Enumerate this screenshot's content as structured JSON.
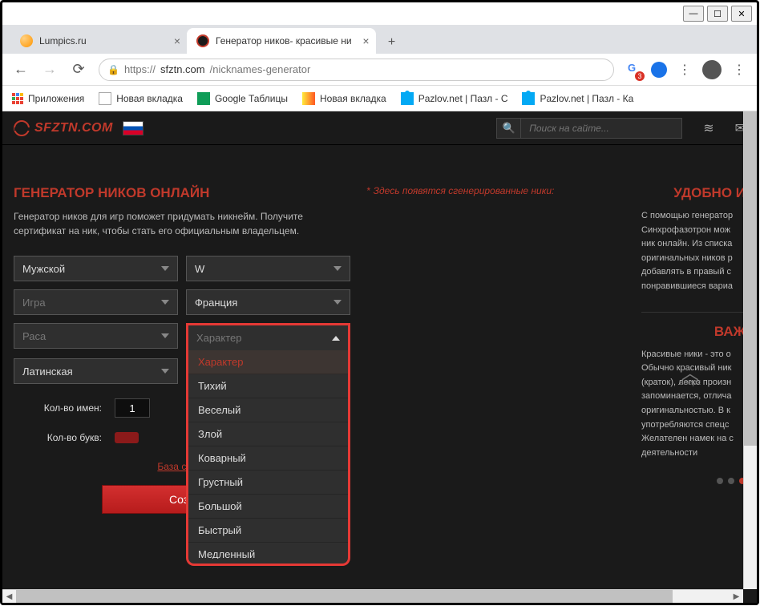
{
  "browser": {
    "tabs": [
      {
        "title": "Lumpics.ru"
      },
      {
        "title": "Генератор ников- красивые ни"
      }
    ],
    "url_proto": "https://",
    "url_host": "sfztn.com",
    "url_path": "/nicknames-generator",
    "badge": "3",
    "bookmarks": {
      "apps": "Приложения",
      "newtab1": "Новая вкладка",
      "gsheets": "Google Таблицы",
      "newtab2": "Новая вкладка",
      "pazlov1": "Pazlov.net | Пазл - С",
      "pazlov2": "Pazlov.net | Пазл - Ка"
    }
  },
  "site": {
    "logo": "SFZTN.COM",
    "search_placeholder": "Поиск на сайте..."
  },
  "generator": {
    "title": "ГЕНЕРАТОР НИКОВ ОНЛАЙН",
    "subtitle": "Генератор ников для игр поможет придумать никнейм. Получите сертификат на ник, чтобы стать его официальным владельцем.",
    "gender": "Мужской",
    "letter": "W",
    "game_ph": "Игра",
    "country": "Франция",
    "race_ph": "Раса",
    "character_ph": "Характер",
    "alphabet": "Латинская",
    "character_options": [
      "Характер",
      "Тихий",
      "Веселый",
      "Злой",
      "Коварный",
      "Грустный",
      "Большой",
      "Быстрый",
      "Медленный"
    ],
    "count_names_label": "Кол-во имен:",
    "count_names_value": "1",
    "count_letters_label": "Кол-во букв:",
    "cert_link": "База серти",
    "create_btn": "Созд"
  },
  "results": {
    "placeholder": "Здесь появятся сгенерированные ники:"
  },
  "sidebar": {
    "title1": "УДОБНО И",
    "text1": "С помощью генератор Синхрофазотрон мож ник онлайн. Из списка оригинальных ников р добавлять в правый с понравившиеся вариа",
    "title2": "ВАЖ",
    "text2": "Красивые ники - это о Обычно красивый ник (краток), легко произн запоминается, отлича оригинальностью. В к употребляются спецс Желателен намек на с деятельности"
  },
  "scroll_top": "вверх"
}
